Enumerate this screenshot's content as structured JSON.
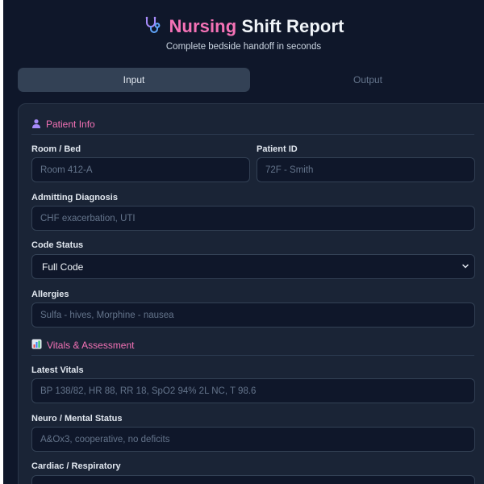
{
  "header": {
    "title_accent": "Nursing",
    "title_rest": "Shift Report",
    "subtitle": "Complete bedside handoff in seconds",
    "icon": "stethoscope-icon"
  },
  "tabs": [
    {
      "label": "Input",
      "active": true
    },
    {
      "label": "Output",
      "active": false
    }
  ],
  "sections": {
    "patient_info": {
      "icon": "person-icon",
      "title": "Patient Info"
    },
    "vitals": {
      "icon": "chart-icon",
      "title": "Vitals & Assessment"
    }
  },
  "fields": {
    "room_bed": {
      "label": "Room / Bed",
      "placeholder": "Room 412-A"
    },
    "patient_id": {
      "label": "Patient ID",
      "placeholder": "72F - Smith"
    },
    "admitting_diagnosis": {
      "label": "Admitting Diagnosis",
      "placeholder": "CHF exacerbation, UTI"
    },
    "code_status": {
      "label": "Code Status",
      "value": "Full Code"
    },
    "allergies": {
      "label": "Allergies",
      "placeholder": "Sulfa - hives, Morphine - nausea"
    },
    "latest_vitals": {
      "label": "Latest Vitals",
      "placeholder": "BP 138/82, HR 88, RR 18, SpO2 94% 2L NC, T 98.6"
    },
    "neuro": {
      "label": "Neuro / Mental Status",
      "placeholder": "A&Ox3, cooperative, no deficits"
    },
    "cardiac": {
      "label": "Cardiac / Respiratory",
      "placeholder": ""
    }
  },
  "colors": {
    "accent": "#f472b6",
    "background": "#0f172a",
    "card": "#1a2436"
  }
}
